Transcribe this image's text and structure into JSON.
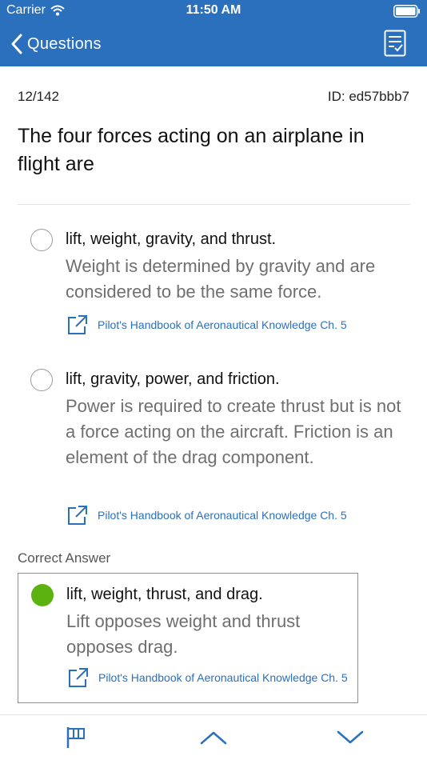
{
  "status_bar": {
    "carrier": "Carrier",
    "time": "11:50 AM"
  },
  "nav": {
    "back_label": "Questions"
  },
  "meta": {
    "progress": "12/142",
    "question_id": "ID: ed57bbb7"
  },
  "question": {
    "text": "The four forces acting on an airplane in flight are"
  },
  "options": [
    {
      "answer": "lift, weight, gravity, and thrust.",
      "explanation": "Weight is determined by gravity and are considered to be the same force.",
      "reference": "Pilot's Handbook of Aeronautical Knowledge Ch. 5"
    },
    {
      "answer": "lift, gravity, power, and friction.",
      "explanation": "Power is required to create thrust but is not a force acting on the aircraft. Friction is an element of the drag component.",
      "reference": "Pilot's Handbook of Aeronautical Knowledge Ch. 5"
    }
  ],
  "correct": {
    "label": "Correct Answer",
    "answer": "lift, weight, thrust, and drag.",
    "explanation": "Lift opposes weight and thrust opposes drag.",
    "reference": "Pilot's Handbook of Aeronautical Knowledge Ch. 5"
  },
  "colors": {
    "header": "#2a70bd",
    "link": "#2a70bd",
    "correct": "#5cb30f"
  },
  "icons": [
    "wifi-icon",
    "battery-icon",
    "chevron-left-icon",
    "checklist-icon",
    "external-link-icon",
    "flag-icon",
    "chevron-up-icon",
    "chevron-down-icon"
  ]
}
